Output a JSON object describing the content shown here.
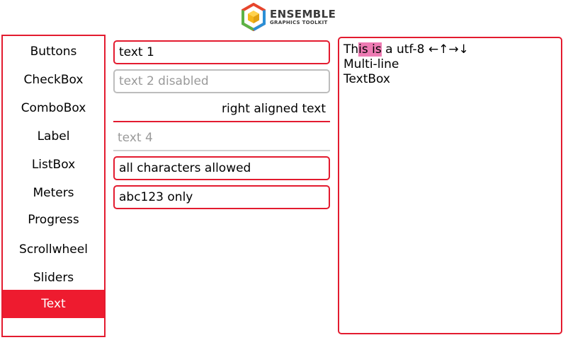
{
  "logo": {
    "line1": "ENSEMBLE",
    "line2": "GRAPHICS TOOLKIT"
  },
  "sidebar": {
    "items": [
      {
        "label": "Buttons"
      },
      {
        "label": "CheckBox"
      },
      {
        "label": "ComboBox"
      },
      {
        "label": "Label"
      },
      {
        "label": "ListBox"
      },
      {
        "label": "Meters"
      },
      {
        "label": "Progress"
      },
      {
        "label": "Scrollwheel"
      },
      {
        "label": "Sliders"
      },
      {
        "label": "Text",
        "selected": true
      }
    ]
  },
  "fields": {
    "text1": "text 1",
    "text2": "text 2 disabled",
    "right": "right aligned text",
    "text4": "text 4",
    "all_chars": "all characters allowed",
    "abc": "abc123 only"
  },
  "multiline": {
    "line1_pre": "Th",
    "line1_sel": "is is",
    "line1_post": " a utf-8 ←↑→↓",
    "line2": "Multi-line",
    "line3": "TextBox"
  },
  "colors": {
    "accent": "#ee1b2f",
    "selection": "#ee7bb3",
    "disabled": "#9a9a9a"
  }
}
